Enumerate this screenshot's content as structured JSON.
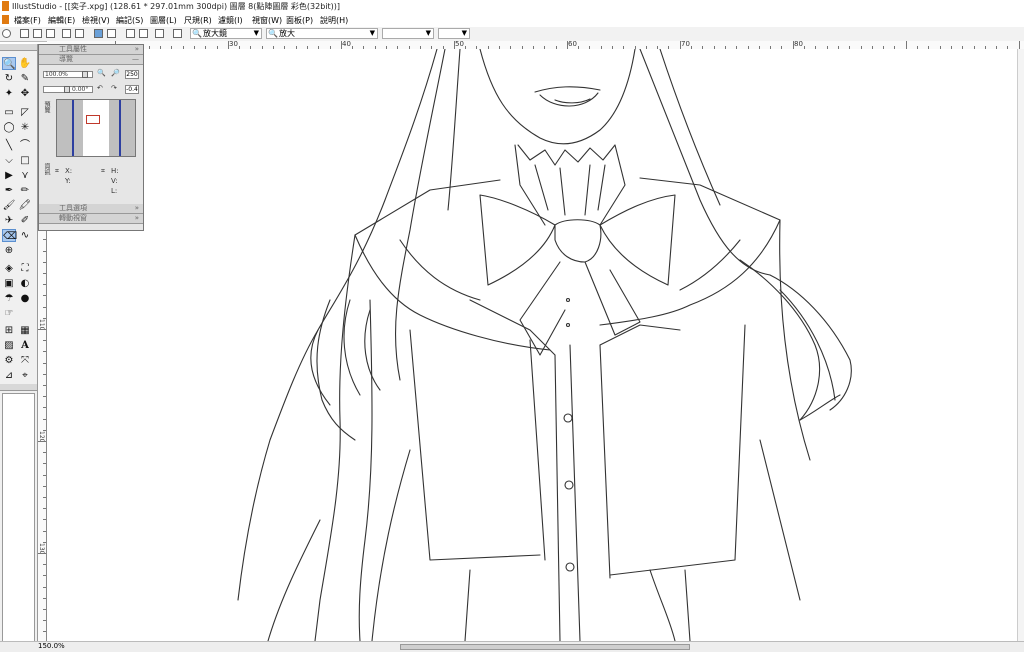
{
  "window": {
    "title": "IllustStudio - [[奕子.xpg] (128.61 * 297.01mm 300dpi)   圖層 8(點陣圖層 彩色(32bit))]"
  },
  "menu": [
    "檔案(F)",
    "編輯(E)",
    "檢視(V)",
    "編記(S)",
    "圖層(L)",
    "尺規(R)",
    "濾鏡(I)",
    "視窗(W)",
    "面板(P)",
    "說明(H)"
  ],
  "toolbar": {
    "tool_combo": "放大鏡",
    "mode_combo": "放大"
  },
  "ruler": {
    "top_labels": [
      "30",
      "40",
      "50",
      "60",
      "70",
      "80"
    ],
    "left_labels": [
      "100",
      "110",
      "120",
      "130"
    ]
  },
  "navigator": {
    "tool_property_header": "工具屬性",
    "navigator_header": "導覽",
    "zoom_value": "100.0%",
    "zoom_field": "250",
    "rotation_value": "0.00°",
    "rotation_field": "-0.4",
    "preview_tab": "預覽",
    "info_tab": "資訊",
    "labels": {
      "x": "X:",
      "y": "Y:",
      "h": "H:",
      "v": "V:",
      "l": "L:"
    },
    "tool_select_header": "工具選項",
    "transform_header": "轉動視窗"
  },
  "status": {
    "zoom": "150.0%"
  }
}
